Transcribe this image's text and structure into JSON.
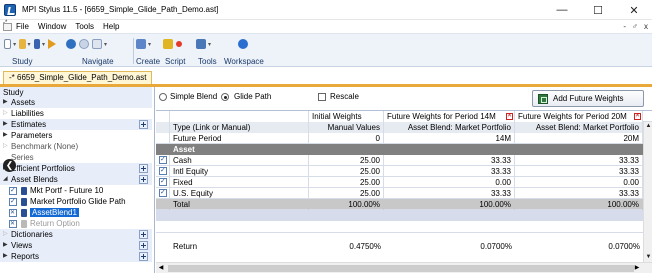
{
  "window": {
    "title": "MPI Stylus 11.5 - [6659_Simple_Glide_Path_Demo.ast]",
    "controls": [
      "—",
      "☐",
      "✕"
    ]
  },
  "menu": {
    "items": [
      "File",
      "Window",
      "Tools",
      "Help"
    ],
    "mdi_controls": [
      "-",
      "♂",
      "x"
    ]
  },
  "toolbar": {
    "groups": [
      "Study",
      "Navigate",
      "Create",
      "Script",
      "Tools",
      "Workspace"
    ]
  },
  "doc_tab": {
    "label": "-* 6659_Simple_Glide_Path_Demo.ast"
  },
  "tree": {
    "items": [
      {
        "label": "Study",
        "kind": "root"
      },
      {
        "label": "Assets",
        "kind": "section"
      },
      {
        "label": "Liabilities",
        "kind": "item"
      },
      {
        "label": "Estimates",
        "kind": "section"
      },
      {
        "label": "Parameters",
        "kind": "item"
      },
      {
        "label": "Benchmark (None)",
        "kind": "item"
      },
      {
        "label": "Series",
        "kind": "item"
      },
      {
        "label": "Efficient Portfolios",
        "kind": "section"
      },
      {
        "label": "Asset Blends",
        "kind": "section"
      },
      {
        "label": "Mkt Portf - Future 10",
        "kind": "child"
      },
      {
        "label": "Market Portfolio Glide Path",
        "kind": "child"
      },
      {
        "label": "AssetBlend1",
        "kind": "child-selected"
      },
      {
        "label": "Return Option",
        "kind": "child-disabled"
      },
      {
        "label": "Dictionaries",
        "kind": "section"
      },
      {
        "label": "Views",
        "kind": "section"
      },
      {
        "label": "Reports",
        "kind": "section"
      }
    ]
  },
  "options": {
    "simple_blend": "Simple Blend",
    "glide_path": "Glide Path",
    "rescale": "Rescale",
    "add_future_weights": "Add Future Weights"
  },
  "grid": {
    "columns": [
      "",
      "",
      "Initial Weights",
      "Future Weights for Period 14M",
      "Future Weights for Period 20M"
    ],
    "type_row": [
      "Type (Link or Manual)",
      "Manual Values",
      "Asset Blend: Market Portfolio",
      "Asset Blend: Market Portfolio"
    ],
    "future_period_row": [
      "Future Period",
      "0",
      "14M",
      "20M"
    ],
    "asset_header": "Asset",
    "assets": [
      {
        "name": "Cash",
        "initial": "25.00",
        "f14": "33.33",
        "f20": "33.33"
      },
      {
        "name": "Intl Equity",
        "initial": "25.00",
        "f14": "33.33",
        "f20": "33.33"
      },
      {
        "name": "Fixed",
        "initial": "25.00",
        "f14": "0.00",
        "f20": "0.00"
      },
      {
        "name": "U.S. Equity",
        "initial": "25.00",
        "f14": "33.33",
        "f20": "33.33"
      }
    ],
    "total_row": [
      "Total",
      "100.00%",
      "100.00%",
      "100.00%"
    ],
    "partial_row": [
      "Return",
      "0.4750%",
      "0.0700%",
      "0.0700%"
    ]
  }
}
